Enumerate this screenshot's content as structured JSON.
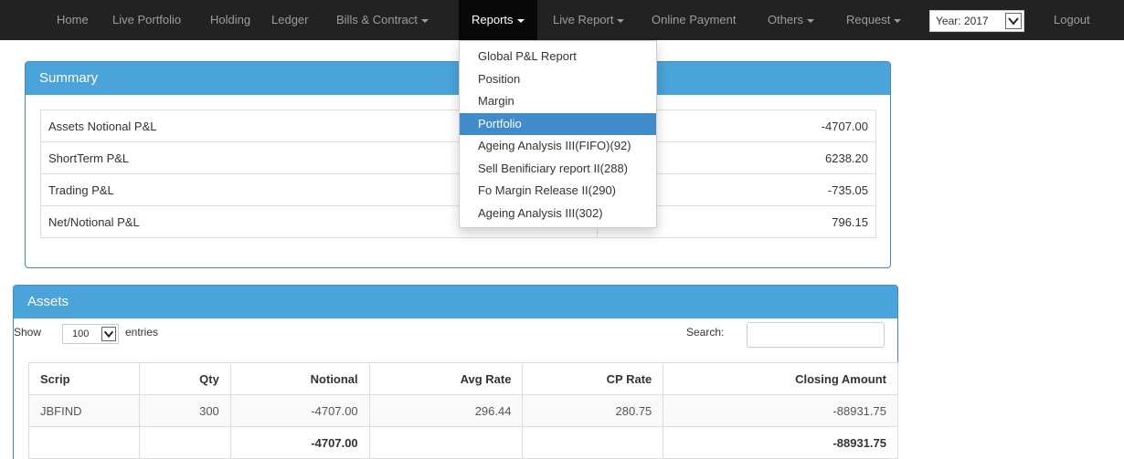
{
  "navbar": {
    "items": [
      {
        "label": "Home",
        "has_caret": false
      },
      {
        "label": "Live Portfolio",
        "has_caret": false
      },
      {
        "label": "Holding",
        "has_caret": false
      },
      {
        "label": "Ledger",
        "has_caret": false
      },
      {
        "label": "Bills & Contract",
        "has_caret": true
      },
      {
        "label": "Reports",
        "has_caret": true,
        "active": true
      },
      {
        "label": "Live Report",
        "has_caret": true
      },
      {
        "label": "Online Payment",
        "has_caret": false
      },
      {
        "label": "Others",
        "has_caret": true
      },
      {
        "label": "Request",
        "has_caret": true
      }
    ],
    "year_select_value": "Year: 2017",
    "logout_label": "Logout"
  },
  "reports_menu": {
    "items": [
      {
        "label": "Global P&L Report",
        "active": false
      },
      {
        "label": "Position",
        "active": false
      },
      {
        "label": "Margin",
        "active": false
      },
      {
        "label": "Portfolio",
        "active": true
      },
      {
        "label": "Ageing Analysis III(FIFO)(92)",
        "active": false
      },
      {
        "label": "Sell Benificiary report II(288)",
        "active": false
      },
      {
        "label": "Fo Margin Release II(290)",
        "active": false
      },
      {
        "label": "Ageing Analysis III(302)",
        "active": false
      }
    ]
  },
  "summary": {
    "title": "Summary",
    "rows": [
      {
        "label": "Assets Notional P&L",
        "value": "-4707.00"
      },
      {
        "label": "ShortTerm P&L",
        "value": "6238.20"
      },
      {
        "label": "Trading P&L",
        "value": "-735.05"
      },
      {
        "label": "Net/Notional P&L",
        "value": "796.15"
      }
    ]
  },
  "assets": {
    "title": "Assets",
    "show_label": "Show",
    "entries_value": "100",
    "entries_label": "entries",
    "search_label": "Search:",
    "search_value": "",
    "columns": [
      "Scrip",
      "Qty",
      "Notional",
      "Avg Rate",
      "CP Rate",
      "Closing Amount"
    ],
    "rows": [
      {
        "scrip": "JBFIND",
        "qty": "300",
        "notional": "-4707.00",
        "avg_rate": "296.44",
        "cp_rate": "280.75",
        "closing_amount": "-88931.75"
      }
    ],
    "total": {
      "notional": "-4707.00",
      "closing_amount": "-88931.75"
    }
  },
  "colors": {
    "navbar_bg": "#222222",
    "panel_heading": "#4aa3d9",
    "menu_active": "#428bca"
  }
}
